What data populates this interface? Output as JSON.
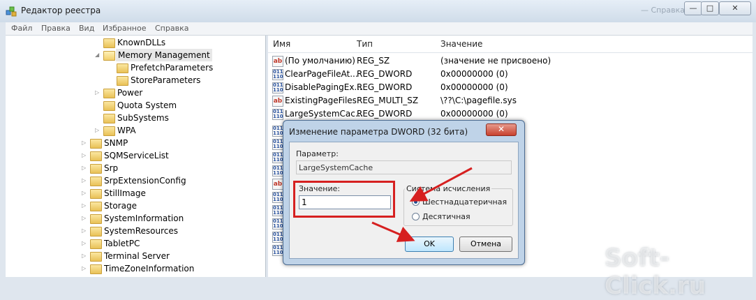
{
  "window": {
    "title": "Редактор реестра",
    "ghost_title": "— Справка",
    "controls": {
      "minimize": "—",
      "maximize": "□",
      "close": "✕"
    }
  },
  "menu": [
    "Файл",
    "Правка",
    "Вид",
    "Избранное",
    "Справка"
  ],
  "tree": [
    {
      "label": "KnownDLLs",
      "arrow": ""
    },
    {
      "label": "Memory Management",
      "arrow": "◢",
      "selected": true
    },
    {
      "label": "PrefetchParameters",
      "arrow": ""
    },
    {
      "label": "StoreParameters",
      "arrow": ""
    },
    {
      "label": "Power",
      "arrow": "▷"
    },
    {
      "label": "Quota System",
      "arrow": ""
    },
    {
      "label": "SubSystems",
      "arrow": ""
    },
    {
      "label": "WPA",
      "arrow": "▷"
    },
    {
      "label": "SNMP",
      "arrow": "▷"
    },
    {
      "label": "SQMServiceList",
      "arrow": "▷"
    },
    {
      "label": "Srp",
      "arrow": "▷"
    },
    {
      "label": "SrpExtensionConfig",
      "arrow": "▷"
    },
    {
      "label": "StillImage",
      "arrow": "▷"
    },
    {
      "label": "Storage",
      "arrow": "▷"
    },
    {
      "label": "SystemInformation",
      "arrow": "▷"
    },
    {
      "label": "SystemResources",
      "arrow": "▷"
    },
    {
      "label": "TabletPC",
      "arrow": "▷"
    },
    {
      "label": "Terminal Server",
      "arrow": "▷"
    },
    {
      "label": "TimeZoneInformation",
      "arrow": "▷"
    }
  ],
  "columns": {
    "name": "Имя",
    "type": "Тип",
    "value": "Значение"
  },
  "values": [
    {
      "icon": "ab",
      "name": "(По умолчанию)",
      "type": "REG_SZ",
      "value": "(значение не присвоено)"
    },
    {
      "icon": "bin",
      "name": "ClearPageFileAt...",
      "type": "REG_DWORD",
      "value": "0x00000000 (0)"
    },
    {
      "icon": "bin",
      "name": "DisablePagingEx...",
      "type": "REG_DWORD",
      "value": "0x00000000 (0)"
    },
    {
      "icon": "ab",
      "name": "ExistingPageFiles",
      "type": "REG_MULTI_SZ",
      "value": "\\??\\C:\\pagefile.sys"
    },
    {
      "icon": "bin",
      "name": "LargeSystemCac...",
      "type": "REG_DWORD",
      "value": "0x00000000 (0)"
    }
  ],
  "dialog": {
    "title": "Изменение параметра DWORD (32 бита)",
    "param_label": "Параметр:",
    "param_name": "LargeSystemCache",
    "value_label": "Значение:",
    "value": "1",
    "radix_group": "Система исчисления",
    "hex_label": "Шестнадцатеричная",
    "dec_label": "Десятичная",
    "ok": "OK",
    "cancel": "Отмена"
  },
  "watermark": "Soft-Click.ru"
}
